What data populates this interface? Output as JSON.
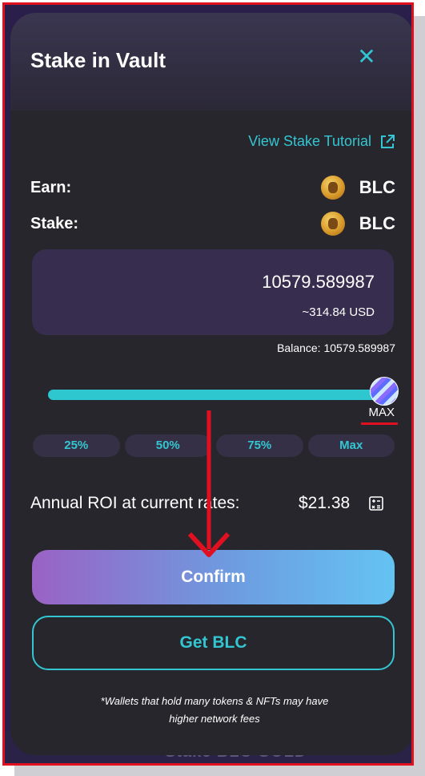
{
  "background": {
    "ghost_text": "Stake BLC GOLD"
  },
  "modal": {
    "title": "Stake in Vault",
    "close_icon": "close-icon",
    "tutorial_link": "View Stake Tutorial",
    "earn": {
      "label": "Earn:",
      "token": "BLC"
    },
    "stake": {
      "label": "Stake:",
      "token": "BLC"
    },
    "input": {
      "amount": "10579.589987",
      "usd": "~314.84 USD"
    },
    "balance": "Balance: 10579.589987",
    "slider": {
      "value_fraction": 1.0,
      "max_label": "MAX"
    },
    "percent_buttons": [
      "25%",
      "50%",
      "75%",
      "Max"
    ],
    "roi": {
      "label": "Annual ROI at current rates:",
      "value": "$21.38"
    },
    "confirm_label": "Confirm",
    "get_label": "Get BLC",
    "footnote_line1": "*Wallets that hold many tokens & NFTs may have",
    "footnote_line2": "higher network fees"
  },
  "colors": {
    "accent": "#33c6d2",
    "annotation": "#e01020",
    "modal_bg": "#27262c",
    "input_bg": "#372e4f"
  }
}
